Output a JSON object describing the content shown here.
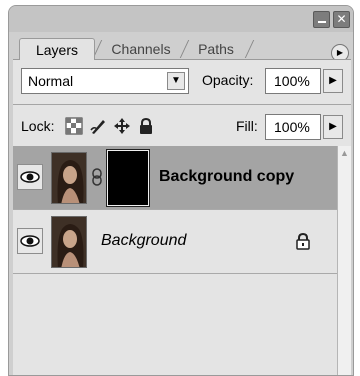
{
  "panel": {
    "window_buttons": {
      "minimize_icon": "minimize-icon",
      "close_icon": "close-icon"
    },
    "tabs": [
      {
        "label": "Layers",
        "active": true
      },
      {
        "label": "Channels",
        "active": false
      },
      {
        "label": "Paths",
        "active": false
      }
    ],
    "menu_icon": "panel-menu-icon"
  },
  "controls": {
    "blend_mode": "Normal",
    "opacity_label": "Opacity:",
    "opacity_value": "100%",
    "lock_label": "Lock:",
    "lock_icons": [
      "lock-transparent-pixels-icon",
      "lock-image-pixels-icon",
      "lock-position-icon",
      "lock-all-icon"
    ],
    "fill_label": "Fill:",
    "fill_value": "100%"
  },
  "layers": [
    {
      "name": "Background copy",
      "visible": true,
      "selected": true,
      "has_mask": true,
      "linked": true,
      "locked": false
    },
    {
      "name": "Background",
      "visible": true,
      "selected": false,
      "has_mask": false,
      "linked": false,
      "locked": true
    }
  ],
  "colors": {
    "selected_row": "#a4a4a4",
    "panel_bg": "#e4e4e4",
    "mask": "#000000"
  }
}
